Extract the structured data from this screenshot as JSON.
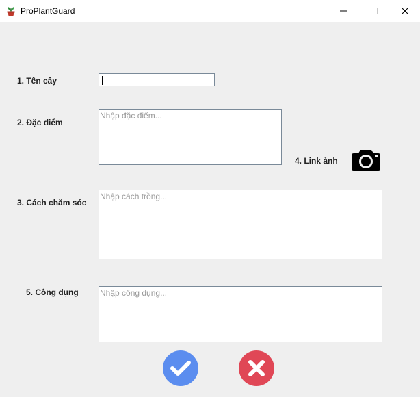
{
  "window": {
    "title": "ProPlantGuard",
    "icon": "potted-plant-icon"
  },
  "form": {
    "name_label": "1. Tên cây",
    "name_value": "",
    "features_label": "2. Đặc điểm",
    "features_placeholder": "Nhập đặc điểm...",
    "care_label": "3. Cách chăm sóc",
    "care_placeholder": "Nhập cách trồng...",
    "image_link_label": "4. Link ảnh",
    "image_icon": "camera-icon",
    "uses_label": "5. Công dụng",
    "uses_placeholder": "Nhập công dụng..."
  },
  "actions": {
    "confirm_icon": "check-icon",
    "cancel_icon": "close-x-icon"
  },
  "colors": {
    "confirm": "#5b8def",
    "cancel": "#e04756"
  }
}
